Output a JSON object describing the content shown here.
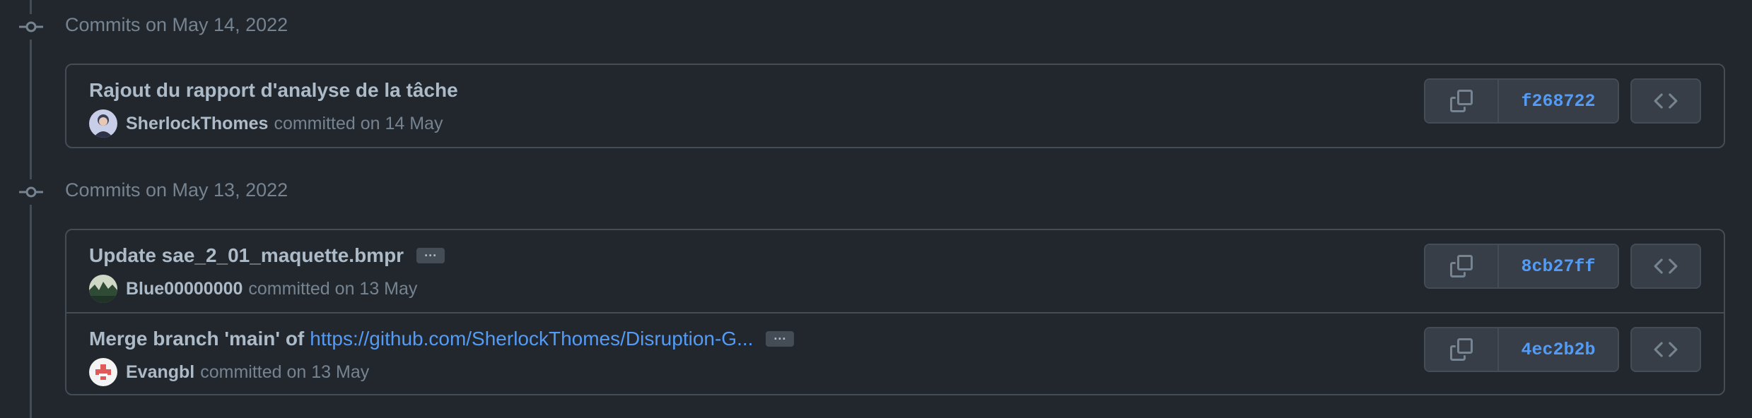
{
  "groups": [
    {
      "title": "Commits on May 14, 2022",
      "commits": [
        {
          "message": "Rajout du rapport d'analyse de la tâche",
          "link_text": "",
          "has_ellipsis": false,
          "author": "SherlockThomes",
          "when": "committed on 14 May",
          "sha": "f268722",
          "avatar_color": "#6c7fb0"
        }
      ]
    },
    {
      "title": "Commits on May 13, 2022",
      "commits": [
        {
          "message": "Update sae_2_01_maquette.bmpr",
          "link_text": "",
          "has_ellipsis": true,
          "author": "Blue00000000",
          "when": "committed on 13 May",
          "sha": "8cb27ff",
          "avatar_color": "#3d5a3a"
        },
        {
          "message": "Merge branch 'main' of",
          "link_text": "https://github.com/SherlockThomes/Disruption-G...",
          "has_ellipsis": true,
          "author": "Evangbl",
          "when": "committed on 13 May",
          "sha": "4ec2b2b",
          "avatar_color": "#e05a5a"
        }
      ]
    }
  ],
  "icons": {
    "commit": "git-commit-icon",
    "copy": "copy-icon",
    "browse": "code-icon",
    "ellipsis": "ellipsis-icon"
  },
  "colors": {
    "background": "#22272e",
    "border": "#444c56",
    "link": "#539bf5",
    "muted": "#768390",
    "text": "#adbac7"
  },
  "ellipsis_label": "···"
}
